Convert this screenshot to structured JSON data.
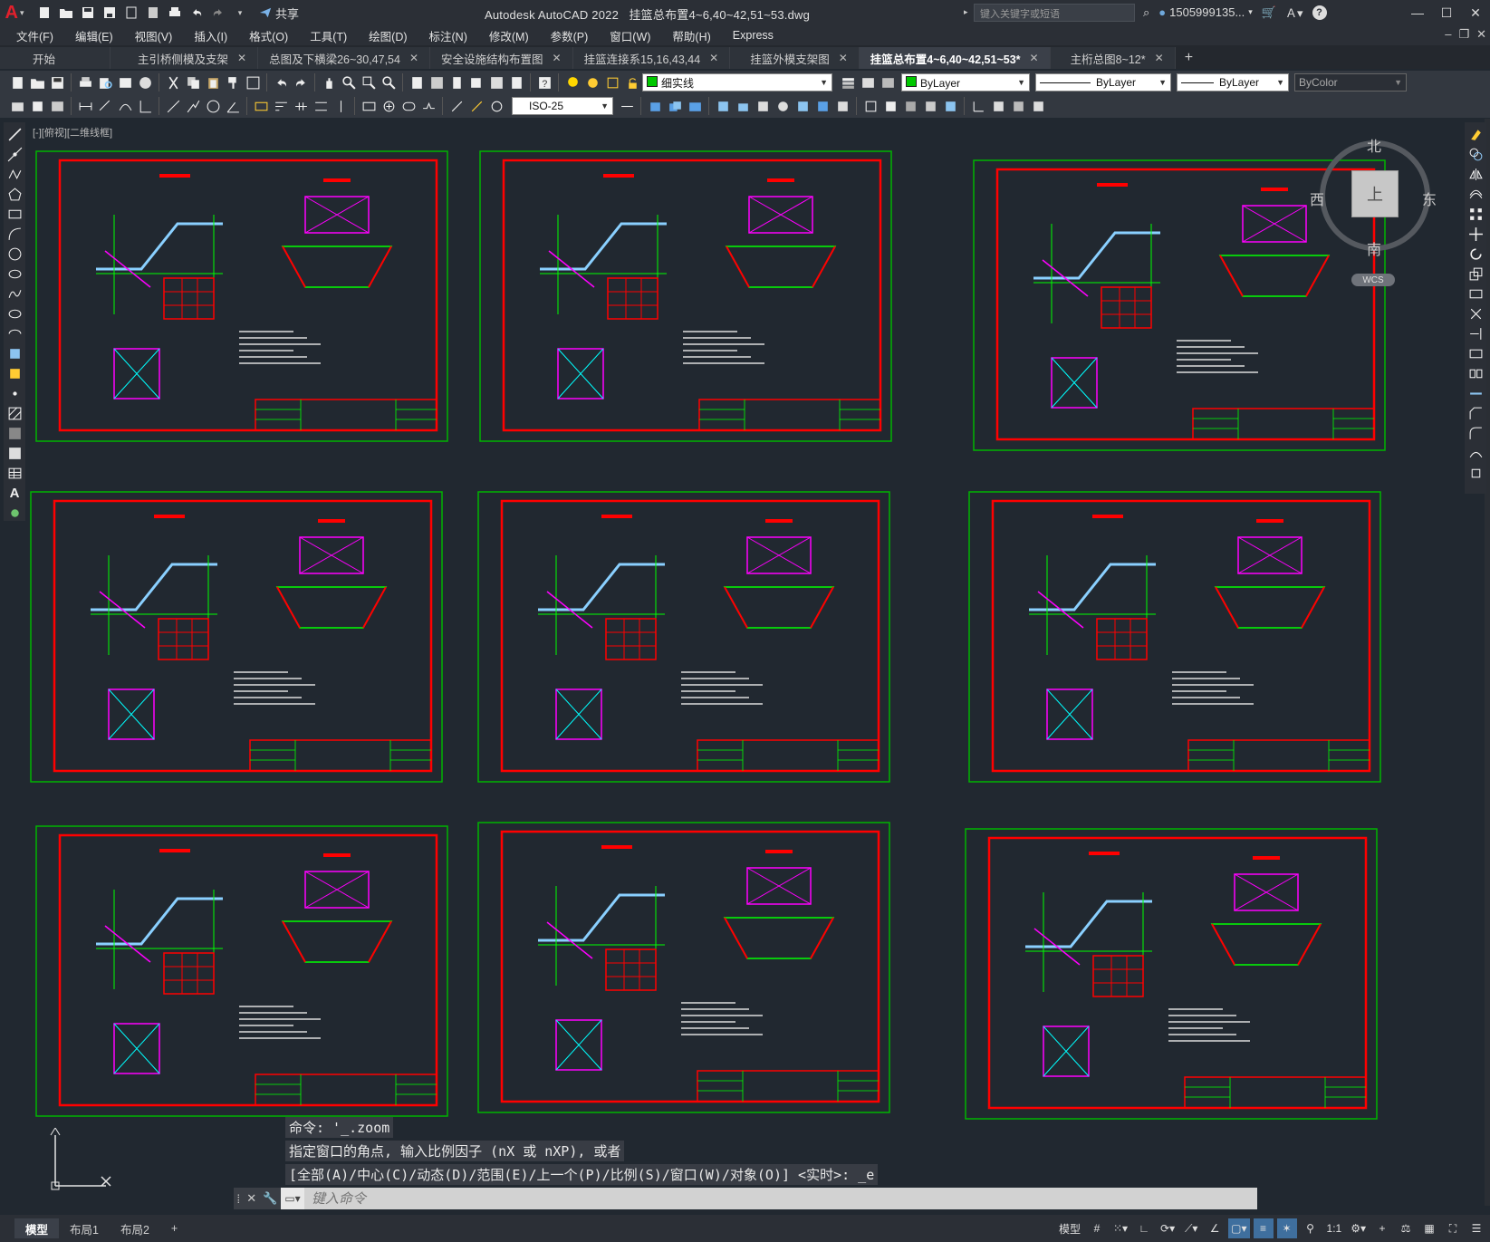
{
  "title_bar": {
    "app_title": "Autodesk AutoCAD 2022",
    "file_name": "挂篮总布置4~6,40~42,51~53.dwg",
    "share_label": "共享",
    "search_placeholder": "键入关键字或短语",
    "user": "1505999135...",
    "help": "?"
  },
  "menu": [
    "文件(F)",
    "编辑(E)",
    "视图(V)",
    "插入(I)",
    "格式(O)",
    "工具(T)",
    "绘图(D)",
    "标注(N)",
    "修改(M)",
    "参数(P)",
    "窗口(W)",
    "帮助(H)",
    "Express"
  ],
  "tabs": [
    {
      "label": "开始",
      "closable": false,
      "active": false
    },
    {
      "label": "主引桥侧模及支架",
      "closable": true,
      "active": false
    },
    {
      "label": "总图及下横梁26~30,47,54",
      "closable": true,
      "active": false
    },
    {
      "label": "安全设施结构布置图",
      "closable": true,
      "active": false
    },
    {
      "label": "挂篮连接系15,16,43,44",
      "closable": true,
      "active": false
    },
    {
      "label": "挂篮外模支架图",
      "closable": true,
      "active": false
    },
    {
      "label": "挂篮总布置4~6,40~42,51~53*",
      "closable": true,
      "active": true
    },
    {
      "label": "主桁总图8~12*",
      "closable": true,
      "active": false
    }
  ],
  "properties": {
    "layer": "细实线",
    "color": "ByLayer",
    "linetype": "ByLayer",
    "lineweight": "ByLayer",
    "plotstyle": "ByColor",
    "dimstyle": "ISO-25"
  },
  "viewport_label": "[-][俯视][二维线框]",
  "viewcube": {
    "north": "北",
    "south": "南",
    "west": "西",
    "east": "东",
    "face": "上",
    "wcs": "WCS"
  },
  "command_history": [
    "命令: '_.zoom",
    "指定窗口的角点, 输入比例因子 (nX 或 nXP), 或者",
    "[全部(A)/中心(C)/动态(D)/范围(E)/上一个(P)/比例(S)/窗口(W)/对象(O)] <实时>: _e"
  ],
  "command_placeholder": "键入命令",
  "layout_tabs": [
    {
      "label": "模型",
      "active": true
    },
    {
      "label": "布局1",
      "active": false
    },
    {
      "label": "布局2",
      "active": false
    }
  ],
  "status": {
    "model": "模型",
    "scale": "1:1"
  },
  "colors": {
    "frame_green": "#00b400",
    "border_red": "#ff0000",
    "draw_green": "#00ff00",
    "magenta": "#ff00ff",
    "cyan": "#00ffff"
  }
}
